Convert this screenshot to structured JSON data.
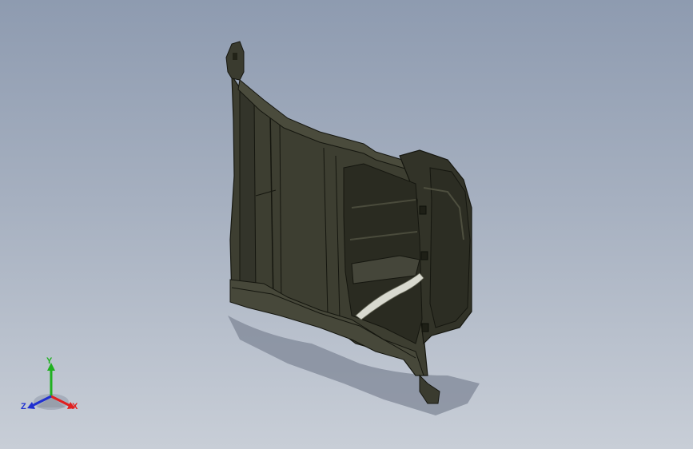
{
  "viewport": {
    "background_top": "#8e9bb0",
    "background_bottom": "#c8ced7"
  },
  "model": {
    "body_color": "#3b3c30",
    "edge_color": "#15160f",
    "highlight_color": "#d8d9cf",
    "shadow_color": "#7a8290"
  },
  "triad": {
    "x_label": "X",
    "y_label": "Y",
    "z_label": "Z",
    "x_color": "#e02020",
    "y_color": "#20b020",
    "z_color": "#2030d0"
  }
}
